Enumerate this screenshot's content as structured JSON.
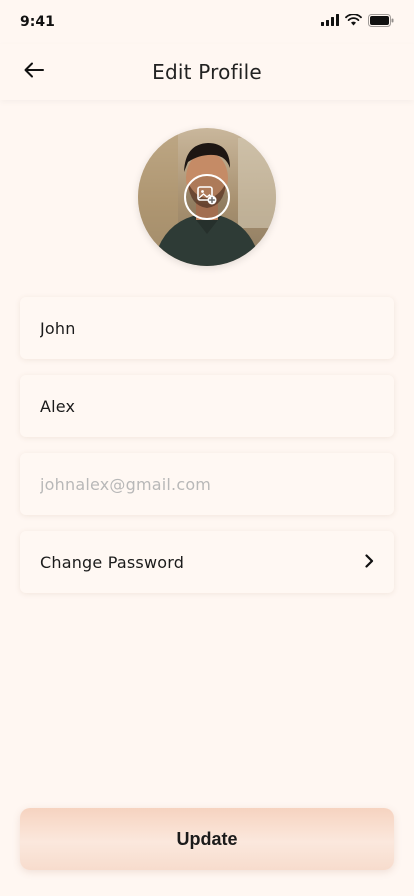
{
  "status_bar": {
    "time": "9:41"
  },
  "header": {
    "title": "Edit Profile"
  },
  "profile": {
    "first_name": "John",
    "last_name": "Alex",
    "email_placeholder": "johnalex@gmail.com",
    "change_password_label": "Change Password"
  },
  "actions": {
    "update_label": "Update"
  },
  "icons": {
    "back": "arrow-left-icon",
    "camera": "image-add-icon",
    "chevron": "chevron-right-icon",
    "signal": "signal-icon",
    "wifi": "wifi-icon",
    "battery": "battery-icon"
  },
  "colors": {
    "background": "#fff7f2",
    "accent": "#f6d3c0",
    "text": "#1b1b1b",
    "placeholder": "#b8b8b8"
  }
}
